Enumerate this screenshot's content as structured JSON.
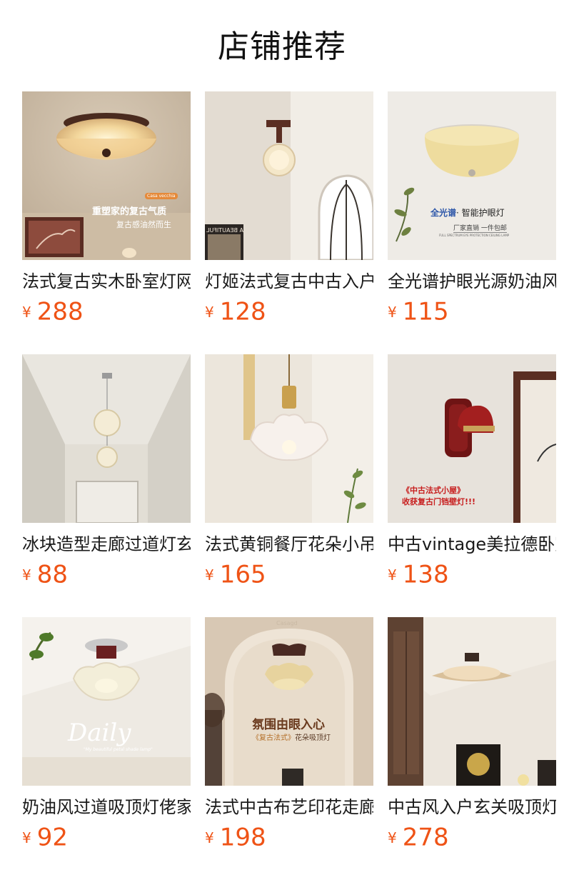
{
  "header": {
    "title": "店铺推荐"
  },
  "currency_symbol": "¥",
  "products": [
    {
      "name": "法式复古实木卧室灯网红",
      "price": "288",
      "overlay": {
        "tag": "Casa vecchia",
        "line1": "重塑家的复古气质",
        "line2": "复古感油然而生"
      }
    },
    {
      "name": "灯姬法式复古中古入户灯",
      "price": "128",
      "overlay": {
        "sign": "A BEAUTIFUL"
      }
    },
    {
      "name": "全光谱护眼光源奶油风灯",
      "price": "115",
      "overlay": {
        "line1a": "全光谱",
        "line1b": "· 智能护眼灯",
        "line2": "厂家直销 一件包邮",
        "line3": "FULL SPECTRUM EYE PROTECTION CEILING LAMP"
      }
    },
    {
      "name": "冰块造型走廊过道灯玄关",
      "price": "88",
      "overlay": {}
    },
    {
      "name": "法式黄铜餐厅花朵小吊灯",
      "price": "165",
      "overlay": {}
    },
    {
      "name": "中古vintage美拉德卧室壁灯",
      "price": "138",
      "overlay": {
        "line1": "《中古法式小屋》",
        "line2": "收获复古门铛壁灯!!!"
      }
    },
    {
      "name": "奶油风过道吸顶灯佬家",
      "price": "92",
      "overlay": {
        "script": "Daily",
        "caption": "\"My beautiful petal shade lamp\""
      }
    },
    {
      "name": "法式中古布艺印花走廊灯",
      "price": "198",
      "overlay": {
        "line1": "氛围由眼入心",
        "tag": "《复古法式》",
        "line2b": "花朵吸顶灯",
        "wm": "Casagd"
      }
    },
    {
      "name": "中古风入户玄关吸顶灯具",
      "price": "278",
      "overlay": {}
    }
  ]
}
